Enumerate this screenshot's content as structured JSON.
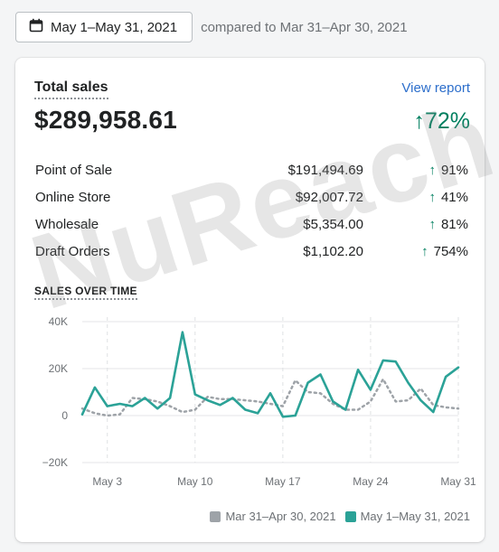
{
  "toolbar": {
    "date_range": "May 1–May 31, 2021",
    "compare_text": "compared to Mar 31–Apr 30, 2021"
  },
  "card": {
    "title": "Total sales",
    "view_report": "View report",
    "total": "$289,958.61",
    "total_change": "72%",
    "rows": [
      {
        "label": "Point of Sale",
        "value": "$191,494.69",
        "change": "91%"
      },
      {
        "label": "Online Store",
        "value": "$92,007.72",
        "change": "41%"
      },
      {
        "label": "Wholesale",
        "value": "$5,354.00",
        "change": "81%"
      },
      {
        "label": "Draft Orders",
        "value": "$1,102.20",
        "change": "754%"
      }
    ],
    "chart_title": "SALES OVER TIME"
  },
  "watermark": "NuReach",
  "colors": {
    "accent_teal": "#2ba297",
    "comparison_gray": "#9ea3a8",
    "positive_green": "#007f5f",
    "link_blue": "#2c6ecb"
  },
  "chart_data": {
    "type": "line",
    "title": "SALES OVER TIME",
    "x_ticks": [
      "May 3",
      "May 10",
      "May 17",
      "May 24",
      "May 31"
    ],
    "y_ticks": [
      "40K",
      "20K",
      "0",
      "−20K"
    ],
    "ylim": [
      -20000,
      40000
    ],
    "grid": true,
    "legend_position": "bottom-right",
    "x": [
      "May 1",
      "May 2",
      "May 3",
      "May 4",
      "May 5",
      "May 6",
      "May 7",
      "May 8",
      "May 9",
      "May 10",
      "May 11",
      "May 12",
      "May 13",
      "May 14",
      "May 15",
      "May 16",
      "May 17",
      "May 18",
      "May 19",
      "May 20",
      "May 21",
      "May 22",
      "May 23",
      "May 24",
      "May 25",
      "May 26",
      "May 27",
      "May 28",
      "May 29",
      "May 30",
      "May 31"
    ],
    "series": [
      {
        "name": "Mar 31–Apr 30, 2021",
        "style": "dotted",
        "color": "#9ea3a8",
        "values": [
          3000,
          1000,
          0,
          500,
          7500,
          7000,
          6000,
          4000,
          1500,
          2500,
          8000,
          7000,
          7000,
          6500,
          6000,
          5000,
          4000,
          15000,
          10000,
          9500,
          5000,
          2500,
          2500,
          6000,
          15500,
          6000,
          6500,
          11500,
          4500,
          3500,
          3000
        ]
      },
      {
        "name": "May 1–May 31, 2021",
        "style": "solid",
        "color": "#2ba297",
        "values": [
          500,
          12000,
          4000,
          5000,
          4000,
          7500,
          3000,
          7500,
          35500,
          9000,
          6500,
          4500,
          7500,
          2500,
          1000,
          9500,
          -500,
          0,
          14000,
          17500,
          6000,
          2500,
          19500,
          11000,
          23500,
          23000,
          14000,
          6500,
          1500,
          16500,
          20500
        ]
      }
    ]
  }
}
